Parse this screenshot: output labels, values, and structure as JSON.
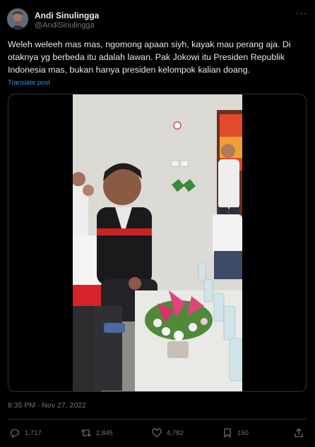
{
  "author": {
    "display_name": "Andi Sinulingga",
    "handle": "@AndiSinulingga"
  },
  "tweet": {
    "text": "Weleh weleeh mas mas, ngomong apaan siyh, kayak mau perang aja. Di otaknya yg berbeda itu adalah lawan. Pak Jokowi itu Presiden Republik Indonesia mas, bukan hanya presiden kelompok kalian doang.",
    "translate_label": "Translate post",
    "timestamp": "8:35 PM · Nov 27, 2022"
  },
  "media": {
    "type": "video"
  },
  "actions": {
    "replies": "1,717",
    "reposts": "2,845",
    "likes": "4,782",
    "bookmarks": "150"
  },
  "icons": {
    "reply": "reply-icon",
    "repost": "repost-icon",
    "like": "like-icon",
    "bookmark": "bookmark-icon",
    "share": "share-icon",
    "more": "more-icon"
  },
  "colors": {
    "background": "#000000",
    "text_primary": "#e7e9ea",
    "text_secondary": "#71767b",
    "link": "#1d9bf0",
    "border": "#2f3336"
  }
}
